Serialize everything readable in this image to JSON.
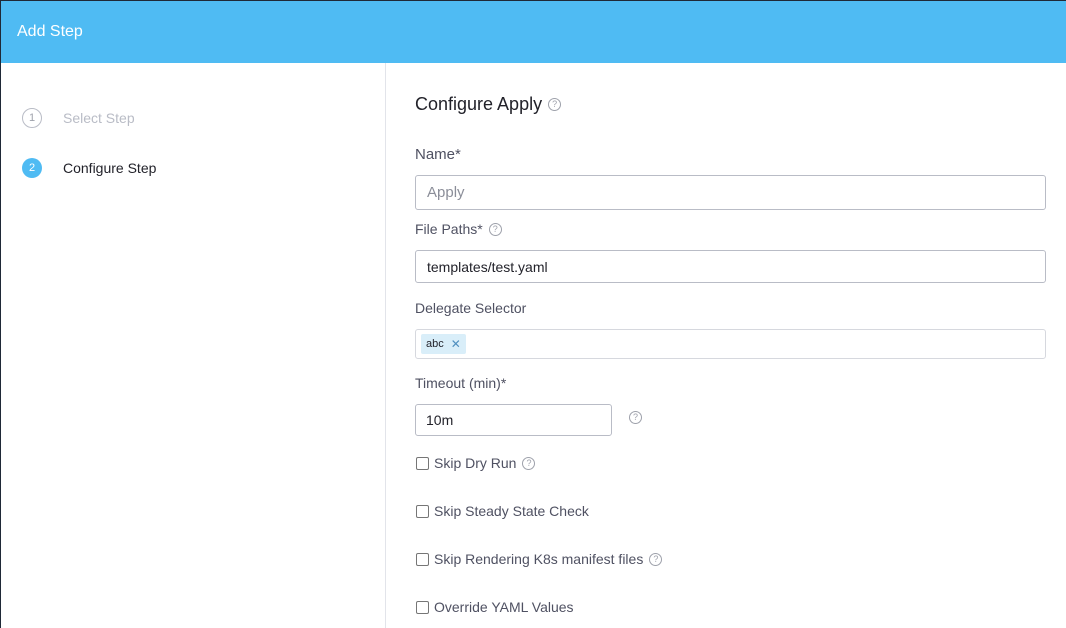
{
  "header": {
    "title": "Add Step"
  },
  "sidebar": {
    "steps": [
      {
        "number": "1",
        "label": "Select Step"
      },
      {
        "number": "2",
        "label": "Configure Step"
      }
    ]
  },
  "main": {
    "title": "Configure Apply",
    "name": {
      "label": "Name*",
      "placeholder": "Apply"
    },
    "file_paths": {
      "label": "File Paths*",
      "value": "templates/test.yaml"
    },
    "delegate_selector": {
      "label": "Delegate Selector",
      "tags": [
        "abc"
      ]
    },
    "timeout": {
      "label": "Timeout (min)*",
      "value": "10m"
    },
    "checkboxes": [
      {
        "label": "Skip Dry Run",
        "checked": false,
        "has_help": true
      },
      {
        "label": "Skip Steady State Check",
        "checked": false,
        "has_help": false
      },
      {
        "label": "Skip Rendering K8s manifest files",
        "checked": false,
        "has_help": true
      },
      {
        "label": "Override YAML Values",
        "checked": false,
        "has_help": false
      }
    ]
  },
  "icons": {
    "help": "?",
    "tag_remove": "✕"
  },
  "colors": {
    "header": "#4fbbf3",
    "active_step": "#4fbbf3"
  }
}
